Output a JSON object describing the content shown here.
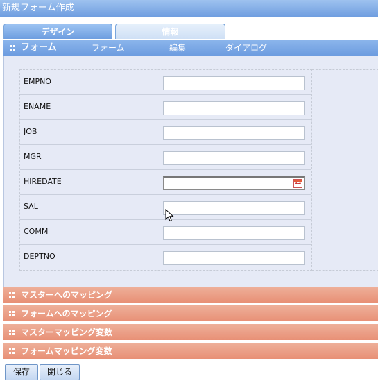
{
  "window": {
    "title": "新規フォーム作成"
  },
  "tabs": [
    {
      "label": "デザイン",
      "active": true
    },
    {
      "label": "情報",
      "active": false
    }
  ],
  "toolbar": {
    "title": "フォーム",
    "menu": [
      "フォーム",
      "編集",
      "ダイアログ"
    ]
  },
  "form": {
    "fields": [
      {
        "label": "EMPNO",
        "value": "",
        "type": "text"
      },
      {
        "label": "ENAME",
        "value": "",
        "type": "text"
      },
      {
        "label": "JOB",
        "value": "",
        "type": "text"
      },
      {
        "label": "MGR",
        "value": "",
        "type": "text"
      },
      {
        "label": "HIREDATE",
        "value": "",
        "type": "date",
        "icon": "calendar-icon",
        "icon_text": "12"
      },
      {
        "label": "SAL",
        "value": "",
        "type": "text"
      },
      {
        "label": "COMM",
        "value": "",
        "type": "text"
      },
      {
        "label": "DEPTNO",
        "value": "",
        "type": "text"
      }
    ]
  },
  "sections": [
    "マスターへのマッピング",
    "フォームへのマッピング",
    "マスターマッピング変数",
    "フォームマッピング変数"
  ],
  "buttons": {
    "save": "保存",
    "close": "閉じる"
  },
  "colors": {
    "title_bar": "#7ea8e4",
    "section_bar": "#e99a80",
    "form_background": "#e6eaf6"
  }
}
